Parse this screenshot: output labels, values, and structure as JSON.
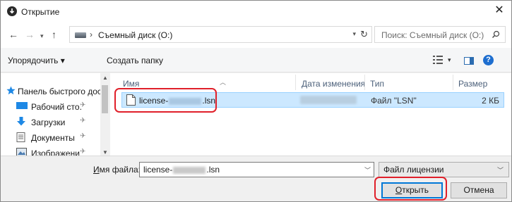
{
  "window": {
    "title": "Открытие",
    "close_glyph": "✕"
  },
  "address_bar": {
    "back_glyph": "←",
    "forward_glyph": "→",
    "up_glyph": "↑",
    "separator": "›",
    "location": "Съемный диск (O:)",
    "refresh_glyph": "↻"
  },
  "search": {
    "placeholder": "Поиск: Съемный диск (O:)"
  },
  "toolbar": {
    "organize_label": "Упорядочить ▾",
    "new_folder_label": "Создать папку",
    "help_glyph": "?"
  },
  "nav_pane": {
    "items": [
      {
        "label": "Панель быстрого доступа",
        "icon": "star-icon"
      },
      {
        "label": "Рабочий сто.",
        "icon": "desktop-icon",
        "pinned": true
      },
      {
        "label": "Загрузки",
        "icon": "download-icon",
        "pinned": true
      },
      {
        "label": "Документы",
        "icon": "documents-icon",
        "pinned": true
      },
      {
        "label": "Изображени",
        "icon": "images-icon",
        "pinned": true
      }
    ],
    "pin_glyph": "✈"
  },
  "file_list": {
    "columns": [
      "Имя",
      "Дата изменения",
      "Тип",
      "Размер"
    ],
    "rows": [
      {
        "name": "license-",
        "name_ext": ".lsn",
        "type": "Файл \"LSN\"",
        "size": "2 КБ",
        "selected": true
      }
    ]
  },
  "bottom": {
    "filename_label_prefix": "И",
    "filename_label_rest": "мя файла:",
    "filename_value_prefix": "license-",
    "filename_value_ext": ".lsn",
    "filetype_value": "Файл лицензии",
    "open_label_prefix": "О",
    "open_label_rest": "ткрыть",
    "cancel_label": "Отмена"
  },
  "colors": {
    "selection": "#cce8ff",
    "highlight_outline": "#e0202a",
    "accent": "#0078d7"
  }
}
